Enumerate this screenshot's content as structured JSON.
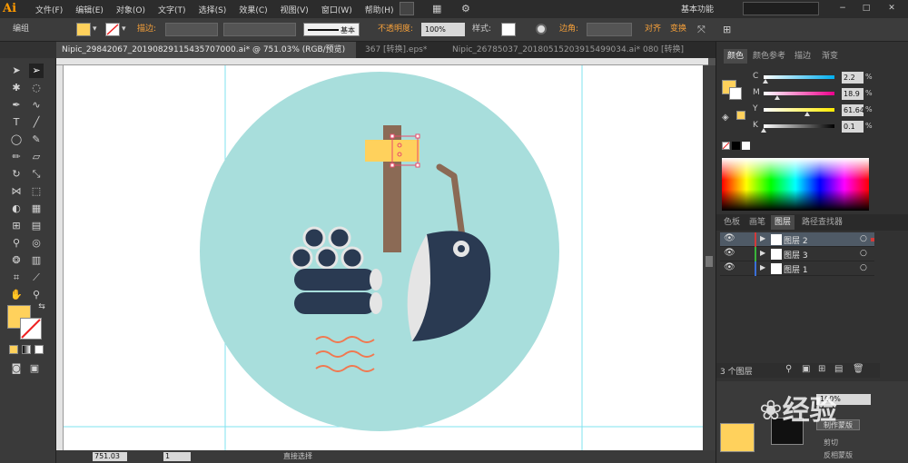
{
  "app": {
    "logo": "Ai",
    "workspace": "基本功能",
    "brand_color": "#ff9a00"
  },
  "menu": [
    "文件(F)",
    "编辑(E)",
    "对象(O)",
    "文字(T)",
    "选择(S)",
    "效果(C)",
    "视图(V)",
    "窗口(W)",
    "帮助(H)"
  ],
  "control_bar": {
    "selection": "编组",
    "stroke_label": "描边:",
    "stroke_style": "基本",
    "opacity_label": "不透明度:",
    "opacity_value": "100%",
    "style_label": "样式:",
    "corner_label": "边角:",
    "align_label": "对齐",
    "transform_label": "变换",
    "fill_color": "#ffd15c"
  },
  "doc_tabs": [
    {
      "label": "Nipic_29842067_20190829115435707000.ai* @ 751.03% (RGB/预览)",
      "active": true
    },
    {
      "label": "367 [转换].eps*",
      "active": false
    },
    {
      "label": "Nipic_26785037_20180515203915499034.ai*",
      "active": false
    },
    {
      "label": "080 [转换]",
      "active": false
    }
  ],
  "color_panel": {
    "tabs": [
      "颜色",
      "颜色参考",
      "描边",
      "渐变"
    ],
    "sliders": [
      {
        "label": "C",
        "value": "2.2",
        "unit": "%",
        "level": 0.022
      },
      {
        "label": "M",
        "value": "18.9",
        "unit": "%",
        "level": 0.189
      },
      {
        "label": "Y",
        "value": "61.64",
        "unit": "%",
        "level": 0.6164
      },
      {
        "label": "K",
        "value": "0.1",
        "unit": "%",
        "level": 0.001
      }
    ]
  },
  "layers_panel": {
    "tabs": [
      "色板",
      "画笔",
      "图层",
      "路径查找器"
    ],
    "layers": [
      {
        "name": "图层 2",
        "color": "#d33a3a",
        "selected": true
      },
      {
        "name": "图层 3",
        "color": "#3ab53a",
        "selected": false
      },
      {
        "name": "图层 1",
        "color": "#3a6fd8",
        "selected": false
      }
    ],
    "count": "3 个图层"
  },
  "transparency_panel": {
    "opacity": "100%",
    "make_mask": "制作蒙版",
    "clip": "剪切",
    "invert_mask": "反相蒙版"
  },
  "status_bar": {
    "zoom": "751.03",
    "page": "1",
    "tool": "直接选择"
  },
  "watermark": "经验",
  "artwork": {
    "circle_color": "#a8dedc",
    "navy": "#2a3a52",
    "wood": "#8b6a55",
    "yellow": "#ffd15c",
    "orange": "#f07850"
  }
}
